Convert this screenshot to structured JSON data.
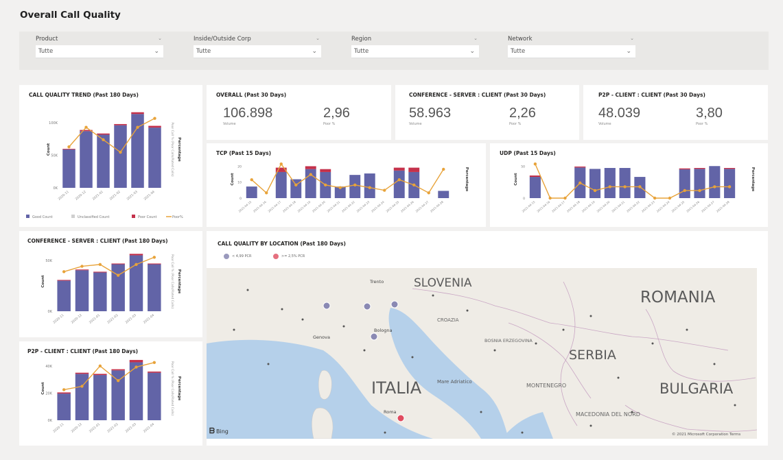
{
  "page_title": "Overall Call Quality",
  "filters": [
    {
      "label": "Product",
      "value": "Tutte"
    },
    {
      "label": "Inside/Outside Corp",
      "value": "Tutte"
    },
    {
      "label": "Region",
      "value": "Tutte"
    },
    {
      "label": "Network",
      "value": "Tutte"
    }
  ],
  "colors": {
    "good": "#6264a7",
    "unknown": "#cfcfcf",
    "poor": "#c4314b",
    "percentage": "#e8a33a",
    "background": "#f2f1f0"
  },
  "kpis": {
    "overall": {
      "title": "OVERALL (Past 30 Days)",
      "volume": "106.898",
      "volume_caption": "Volume",
      "poor": "2,96",
      "poor_caption": "Poor %"
    },
    "conference": {
      "title": "CONFERENCE - SERVER : CLIENT (Past 30 Days)",
      "volume": "58.963",
      "volume_caption": "Volume",
      "poor": "2,26",
      "poor_caption": "Poor %"
    },
    "p2p": {
      "title": "P2P - CLIENT : CLIENT (Past 30 Days)",
      "volume": "48.039",
      "volume_caption": "Volume",
      "poor": "3,80",
      "poor_caption": "Poor %"
    }
  },
  "map": {
    "title": "CALL QUALITY BY LOCATION (Past 180 Days)",
    "legend": [
      {
        "label": "< 4,99 PCR",
        "color": "#9a99bd"
      },
      {
        "label": ">= 2,5% PCR",
        "color": "#e5707f"
      }
    ],
    "labels": {
      "slovenia": "SLOVENIA",
      "romania": "ROMANIA",
      "serbia": "SERBIA",
      "italia": "ITALIA",
      "bulgaria": "BULGARIA",
      "montenegro": "MONTENEGRO",
      "croatia": "CROAZIA",
      "bosnia": "BOSNIA ERZEGOVINA",
      "macedonia": "MACEDONIA DEL NORD",
      "adriatic": "Mare Adriatico",
      "trento": "Trento",
      "bologna": "Bologna",
      "genova": "Genova",
      "roma": "Roma"
    },
    "bing": "Bing",
    "copyright": "© 2021 Microsoft Corporation  Terms"
  },
  "chart_data": [
    {
      "id": "trend",
      "type": "bar",
      "title": "CALL QUALITY TREND (Past 180 Days)",
      "ylabel": "Count",
      "y2label": "Percentage",
      "y2label_note": "Poor Call % (Poor Calls/Rated Calls)",
      "categories": [
        "2020-11",
        "2020-12",
        "2021-01",
        "2021-02",
        "2021-03",
        "2021-04"
      ],
      "yticks": [
        "0K",
        "50K",
        "100K"
      ],
      "ylim": [
        0,
        130
      ],
      "y2lim": [
        0,
        4
      ],
      "series": [
        {
          "name": "Good Count",
          "values": [
            65,
            96,
            90,
            106,
            125,
            102
          ]
        },
        {
          "name": "Unclassified Count",
          "values": [
            0,
            0,
            0,
            0,
            0,
            0
          ]
        },
        {
          "name": "Poor Count",
          "values": [
            1,
            2,
            2,
            2,
            3,
            3
          ]
        }
      ],
      "line": {
        "name": "Poor%",
        "values": [
          2.3,
          3.4,
          2.7,
          2.0,
          3.4,
          3.9
        ]
      }
    },
    {
      "id": "tcp",
      "type": "bar",
      "title": "TCP (Past 15 Days)",
      "ylabel": "Count",
      "y2label": "Percentage",
      "categories": [
        "2021-04-15",
        "2021-04-16",
        "2021-04-17",
        "2021-04-18",
        "2021-04-19",
        "2021-04-20",
        "2021-04-21",
        "2021-04-22",
        "2021-04-23",
        "2021-04-24",
        "2021-04-25",
        "2021-04-26",
        "2021-04-27",
        "2021-04-28"
      ],
      "yticks": [
        "0",
        "10",
        "20"
      ],
      "ylim": [
        0,
        26
      ],
      "series": [
        {
          "name": "Good Count",
          "values": [
            8,
            0,
            18,
            13,
            20,
            18,
            8,
            16,
            17,
            0,
            19,
            18,
            0,
            5
          ]
        },
        {
          "name": "Poor Count",
          "values": [
            0,
            0,
            3,
            0,
            2,
            2,
            0,
            0,
            0,
            0,
            2,
            3,
            0,
            0
          ]
        }
      ],
      "line": {
        "name": "Poor%",
        "values": [
          7,
          2,
          13,
          5,
          9,
          5,
          4,
          5,
          4,
          3,
          7,
          5,
          2,
          11
        ]
      }
    },
    {
      "id": "udp",
      "type": "bar",
      "title": "UDP (Past 15 Days)",
      "ylabel": "Count",
      "y2label": "Percentage",
      "categories": [
        "2021-04-15",
        "2021-04-16",
        "2021-04-17",
        "2021-04-18",
        "2021-04-19",
        "2021-04-20",
        "2021-04-21",
        "2021-04-22",
        "2021-04-23",
        "2021-04-24",
        "2021-04-25",
        "2021-04-26",
        "2021-04-27",
        "2021-04-28"
      ],
      "yticks": [
        "0",
        "50"
      ],
      "ylim": [
        0,
        80
      ],
      "series": [
        {
          "name": "Good Count",
          "values": [
            45,
            0,
            0,
            65,
            62,
            64,
            64,
            45,
            0,
            0,
            61,
            62,
            68,
            62,
            35
          ]
        },
        {
          "name": "Poor Count",
          "values": [
            3,
            0,
            0,
            2,
            0,
            0,
            0,
            0,
            0,
            0,
            2,
            2,
            0,
            2,
            0
          ]
        }
      ],
      "line": {
        "name": "Poor%",
        "values": [
          9,
          0,
          0,
          4,
          2,
          3,
          3,
          3,
          0,
          0,
          2,
          2,
          3,
          3,
          2
        ]
      }
    },
    {
      "id": "conference",
      "type": "bar",
      "title": "CONFERENCE - SERVER : CLIENT (Past 180 Days)",
      "ylabel": "Count",
      "y2label": "Percentage",
      "y2label_note": "Poor Call % (Poor Calls/Rated Calls)",
      "categories": [
        "2020-11",
        "2020-12",
        "2021-01",
        "2021-02",
        "2021-03",
        "2021-04"
      ],
      "yticks": [
        "0K",
        "50K"
      ],
      "ylim": [
        0,
        80
      ],
      "series": [
        {
          "name": "Good Count",
          "values": [
            41,
            55,
            52,
            63,
            75,
            63
          ]
        },
        {
          "name": "Poor Count",
          "values": [
            1,
            1,
            1,
            1,
            2,
            1
          ]
        }
      ],
      "line": {
        "name": "Poor%",
        "values": [
          2.2,
          2.5,
          2.6,
          2.0,
          2.6,
          3.0
        ]
      }
    },
    {
      "id": "p2p",
      "type": "bar",
      "title": "P2P - CLIENT : CLIENT (Past 180 Days)",
      "ylabel": "Count",
      "y2label": "Percentage",
      "y2label_note": "Poor Call % (Poor Calls/Rated Calls)",
      "categories": [
        "2020-11",
        "2020-12",
        "2021-01",
        "2021-02",
        "2021-03",
        "2021-04"
      ],
      "yticks": [
        "0K",
        "20K",
        "40K"
      ],
      "ylim": [
        0,
        55
      ],
      "series": [
        {
          "name": "Good Count",
          "values": [
            23,
            40,
            39,
            43,
            50,
            41
          ]
        },
        {
          "name": "Poor Count",
          "values": [
            1,
            1,
            1,
            1,
            2,
            1
          ]
        }
      ],
      "line": {
        "name": "Poor%",
        "values": [
          2.7,
          3.0,
          4.8,
          3.5,
          4.7,
          5.1
        ]
      }
    }
  ]
}
